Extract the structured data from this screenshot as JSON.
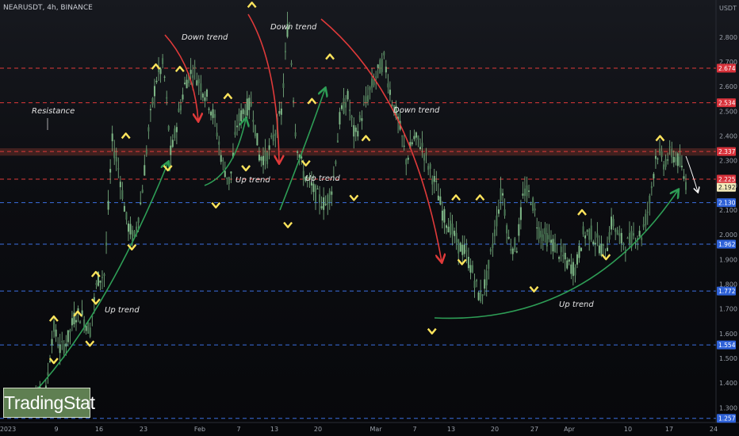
{
  "header": {
    "symbol_line": "NEARUSDT, 4h, BINANCE",
    "currency": "USDT"
  },
  "watermark": "TradingStat",
  "colors": {
    "candle": "#7fb887",
    "up_arrow": "#2e9e56",
    "down_arrow": "#e03a3a",
    "pivot_chevron": "#ffe45c",
    "resistance_line": "#e03a3a",
    "support_line": "#3b6fe0"
  },
  "chart_data": {
    "type": "candlestick",
    "title": "",
    "xlabel": "",
    "ylabel": "",
    "ylim": [
      1.24,
      2.95
    ],
    "y_ticks": [
      "1.300",
      "1.400",
      "1.500",
      "1.600",
      "1.700",
      "1.800",
      "1.900",
      "2.000",
      "2.100",
      "2.200",
      "2.300",
      "2.400",
      "2.500",
      "2.600",
      "2.700",
      "2.800"
    ],
    "x_ticks": [
      "2023",
      "9",
      "16",
      "23",
      "Feb",
      "7",
      "13",
      "20",
      "Mar",
      "7",
      "13",
      "20",
      "27",
      "Apr",
      "10",
      "17",
      "24"
    ],
    "horizontal_levels": [
      {
        "value": 2.674,
        "label": "2.674",
        "style": "resistance"
      },
      {
        "value": 2.534,
        "label": "2.534",
        "style": "resistance"
      },
      {
        "value": 2.337,
        "label": "2.337",
        "style": "resistance"
      },
      {
        "value": 2.225,
        "label": "2.225",
        "style": "resistance"
      },
      {
        "value": 2.192,
        "label": "2.192",
        "style": "current"
      },
      {
        "value": 2.13,
        "label": "2.130",
        "style": "support"
      },
      {
        "value": 1.962,
        "label": "1.962",
        "style": "support"
      },
      {
        "value": 1.772,
        "label": "1.772",
        "style": "support"
      },
      {
        "value": 1.554,
        "label": "1.554",
        "style": "support"
      },
      {
        "value": 1.257,
        "label": "1.257",
        "style": "support"
      }
    ],
    "resistance_zone": [
      2.32,
      2.35
    ],
    "annotations": [
      "Down trend",
      "Down trend",
      "Down trend",
      "Up trend",
      "Up trend",
      "Up trend",
      "Up trend",
      "Resistance"
    ],
    "price_path": [
      [
        0,
        1.33
      ],
      [
        2,
        1.35
      ],
      [
        3,
        1.36
      ],
      [
        4,
        1.63
      ],
      [
        5,
        1.53
      ],
      [
        6,
        1.58
      ],
      [
        7,
        1.68
      ],
      [
        8,
        1.67
      ],
      [
        9,
        1.61
      ],
      [
        10,
        1.82
      ],
      [
        11,
        1.84
      ],
      [
        12,
        2.38
      ],
      [
        13,
        2.25
      ],
      [
        14,
        2.05
      ],
      [
        15,
        1.98
      ],
      [
        16,
        2.15
      ],
      [
        17,
        2.43
      ],
      [
        18,
        2.63
      ],
      [
        19,
        2.69
      ],
      [
        20,
        2.32
      ],
      [
        21,
        2.48
      ],
      [
        22,
        2.62
      ],
      [
        23,
        2.67
      ],
      [
        24,
        2.61
      ],
      [
        25,
        2.55
      ],
      [
        26,
        2.46
      ],
      [
        27,
        2.29
      ],
      [
        28,
        2.21
      ],
      [
        29,
        2.45
      ],
      [
        30,
        2.51
      ],
      [
        31,
        2.53
      ],
      [
        32,
        2.32
      ],
      [
        33,
        2.31
      ],
      [
        34,
        2.4
      ],
      [
        35,
        2.49
      ],
      [
        36,
        2.9
      ],
      [
        37,
        2.39
      ],
      [
        38,
        2.25
      ],
      [
        39,
        2.2
      ],
      [
        40,
        2.15
      ],
      [
        41,
        2.12
      ],
      [
        42,
        2.2
      ],
      [
        43,
        2.48
      ],
      [
        44,
        2.56
      ],
      [
        45,
        2.39
      ],
      [
        46,
        2.49
      ],
      [
        47,
        2.58
      ],
      [
        48,
        2.65
      ],
      [
        49,
        2.71
      ],
      [
        50,
        2.55
      ],
      [
        51,
        2.45
      ],
      [
        52,
        2.3
      ],
      [
        53,
        2.39
      ],
      [
        54,
        2.37
      ],
      [
        55,
        2.28
      ],
      [
        56,
        2.2
      ],
      [
        57,
        2.08
      ],
      [
        58,
        2.03
      ],
      [
        59,
        1.96
      ],
      [
        60,
        1.93
      ],
      [
        61,
        1.85
      ],
      [
        62,
        1.74
      ],
      [
        63,
        1.83
      ],
      [
        64,
        2.01
      ],
      [
        65,
        2.19
      ],
      [
        66,
        1.96
      ],
      [
        67,
        1.95
      ],
      [
        68,
        2.18
      ],
      [
        69,
        2.15
      ],
      [
        70,
        2.02
      ],
      [
        71,
        1.99
      ],
      [
        72,
        1.96
      ],
      [
        73,
        1.92
      ],
      [
        74,
        1.88
      ],
      [
        75,
        1.86
      ],
      [
        76,
        2.0
      ],
      [
        77,
        2.01
      ],
      [
        78,
        1.97
      ],
      [
        79,
        1.92
      ],
      [
        80,
        2.06
      ],
      [
        81,
        1.98
      ],
      [
        82,
        1.96
      ],
      [
        83,
        2.0
      ],
      [
        84,
        2.0
      ],
      [
        85,
        2.12
      ],
      [
        86,
        2.34
      ],
      [
        87,
        2.29
      ],
      [
        88,
        2.33
      ],
      [
        89,
        2.3
      ],
      [
        90,
        2.21
      ]
    ],
    "pivot_highs": [
      [
        5,
        1.66
      ],
      [
        9,
        1.68
      ],
      [
        12,
        1.84
      ],
      [
        17,
        2.4
      ],
      [
        22,
        2.68
      ],
      [
        26,
        2.67
      ],
      [
        34,
        2.56
      ],
      [
        38,
        2.93
      ],
      [
        48,
        2.54
      ],
      [
        51,
        2.72
      ],
      [
        57,
        2.39
      ],
      [
        72,
        2.15
      ],
      [
        76,
        2.15
      ],
      [
        93,
        2.09
      ],
      [
        106,
        2.39
      ]
    ],
    "pivot_lows": [
      [
        5,
        1.49
      ],
      [
        11,
        1.56
      ],
      [
        12,
        1.73
      ],
      [
        18,
        1.95
      ],
      [
        24,
        2.27
      ],
      [
        32,
        2.12
      ],
      [
        37,
        2.27
      ],
      [
        44,
        2.04
      ],
      [
        47,
        2.29
      ],
      [
        55,
        2.15
      ],
      [
        68,
        1.61
      ],
      [
        73,
        1.89
      ],
      [
        85,
        1.78
      ],
      [
        97,
        1.91
      ]
    ]
  }
}
